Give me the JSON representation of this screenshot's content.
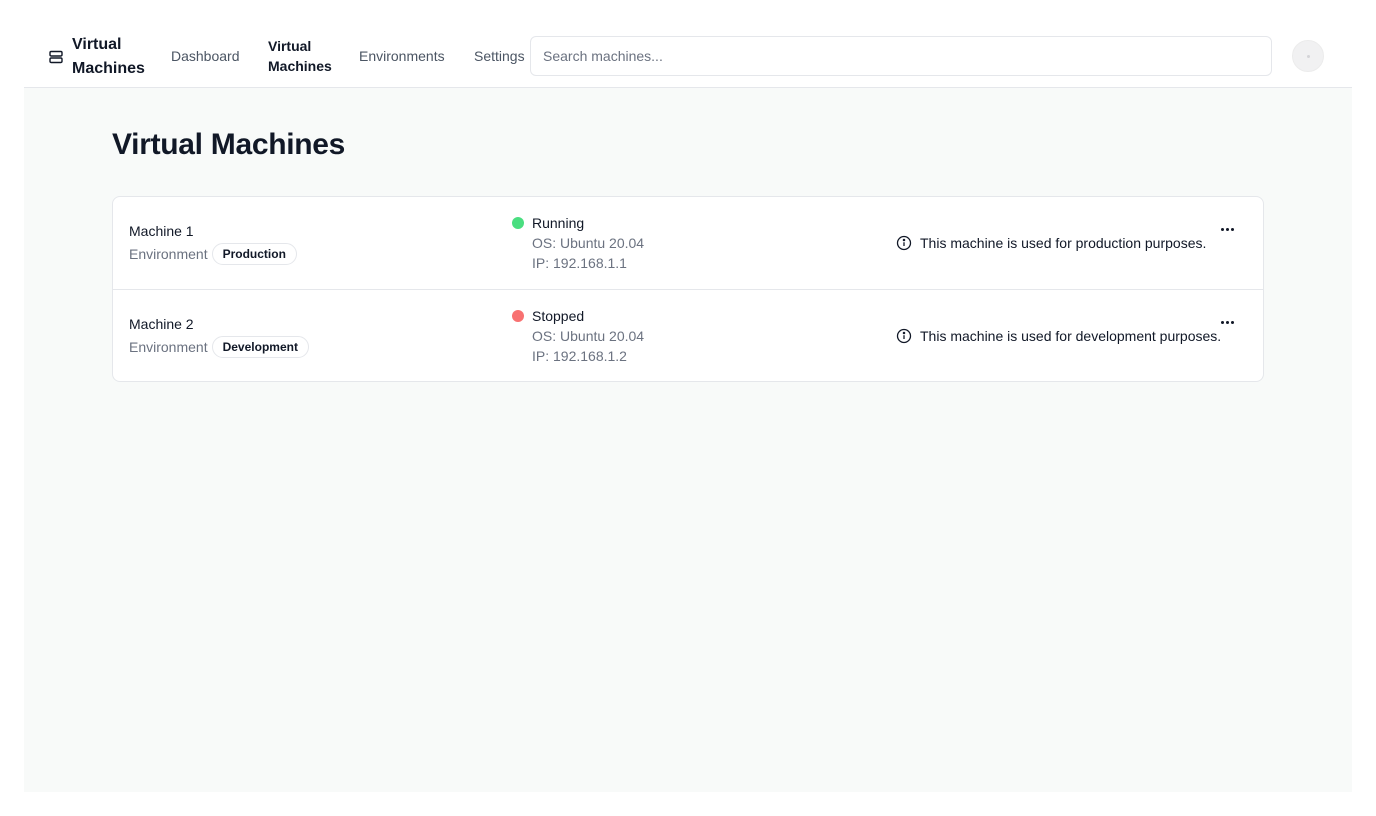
{
  "header": {
    "brand": {
      "icon": "server-icon",
      "title": "Virtual Machines"
    },
    "nav": [
      {
        "label": "Dashboard",
        "active": false
      },
      {
        "label": "Virtual Machines",
        "active": true
      },
      {
        "label": "Environments",
        "active": false
      },
      {
        "label": "Settings",
        "active": false
      }
    ],
    "search": {
      "placeholder": "Search machines...",
      "value": ""
    },
    "avatar": {
      "icon": "user-avatar"
    }
  },
  "page": {
    "title": "Virtual Machines"
  },
  "machines": [
    {
      "name": "Machine 1",
      "environment_label": "Environment",
      "environment": "Production",
      "status": "Running",
      "status_color": "#4ade80",
      "os": "OS: Ubuntu 20.04",
      "ip": "IP: 192.168.1.1",
      "note": "This machine is used for production purposes."
    },
    {
      "name": "Machine 2",
      "environment_label": "Environment",
      "environment": "Development",
      "status": "Stopped",
      "status_color": "#f87171",
      "os": "OS: Ubuntu 20.04",
      "ip": "IP: 192.168.1.2",
      "note": "This machine is used for development purposes."
    }
  ]
}
